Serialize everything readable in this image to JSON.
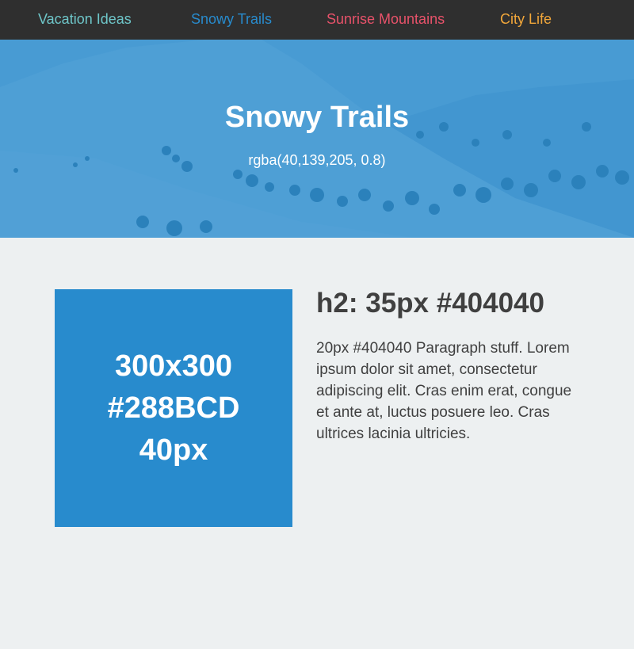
{
  "nav": {
    "items": [
      {
        "label": "Vacation Ideas",
        "color": "#6ec6c9"
      },
      {
        "label": "Snowy Trails",
        "color": "#288bcd"
      },
      {
        "label": "Sunrise Mountains",
        "color": "#e8526a"
      },
      {
        "label": "City Life",
        "color": "#f2a73a"
      }
    ]
  },
  "hero": {
    "title": "Snowy Trails",
    "subtitle": "rgba(40,139,205, 0.8)",
    "overlay_color": "rgba(40,139,205,0.8)"
  },
  "feature": {
    "box": {
      "lines": [
        "300x300",
        "#288BCD",
        "40px"
      ],
      "color": "#288BCD"
    },
    "heading": "h2: 35px #404040",
    "paragraph": "20px #404040 Paragraph stuff. Lorem ipsum dolor sit amet, consectetur adipiscing elit. Cras enim erat, congue et ante at, luctus posuere leo. Cras ultrices lacinia ultricies."
  },
  "colors": {
    "nav_background": "#2f2f2f",
    "page_background": "#edf0f1",
    "text": "#404040"
  }
}
